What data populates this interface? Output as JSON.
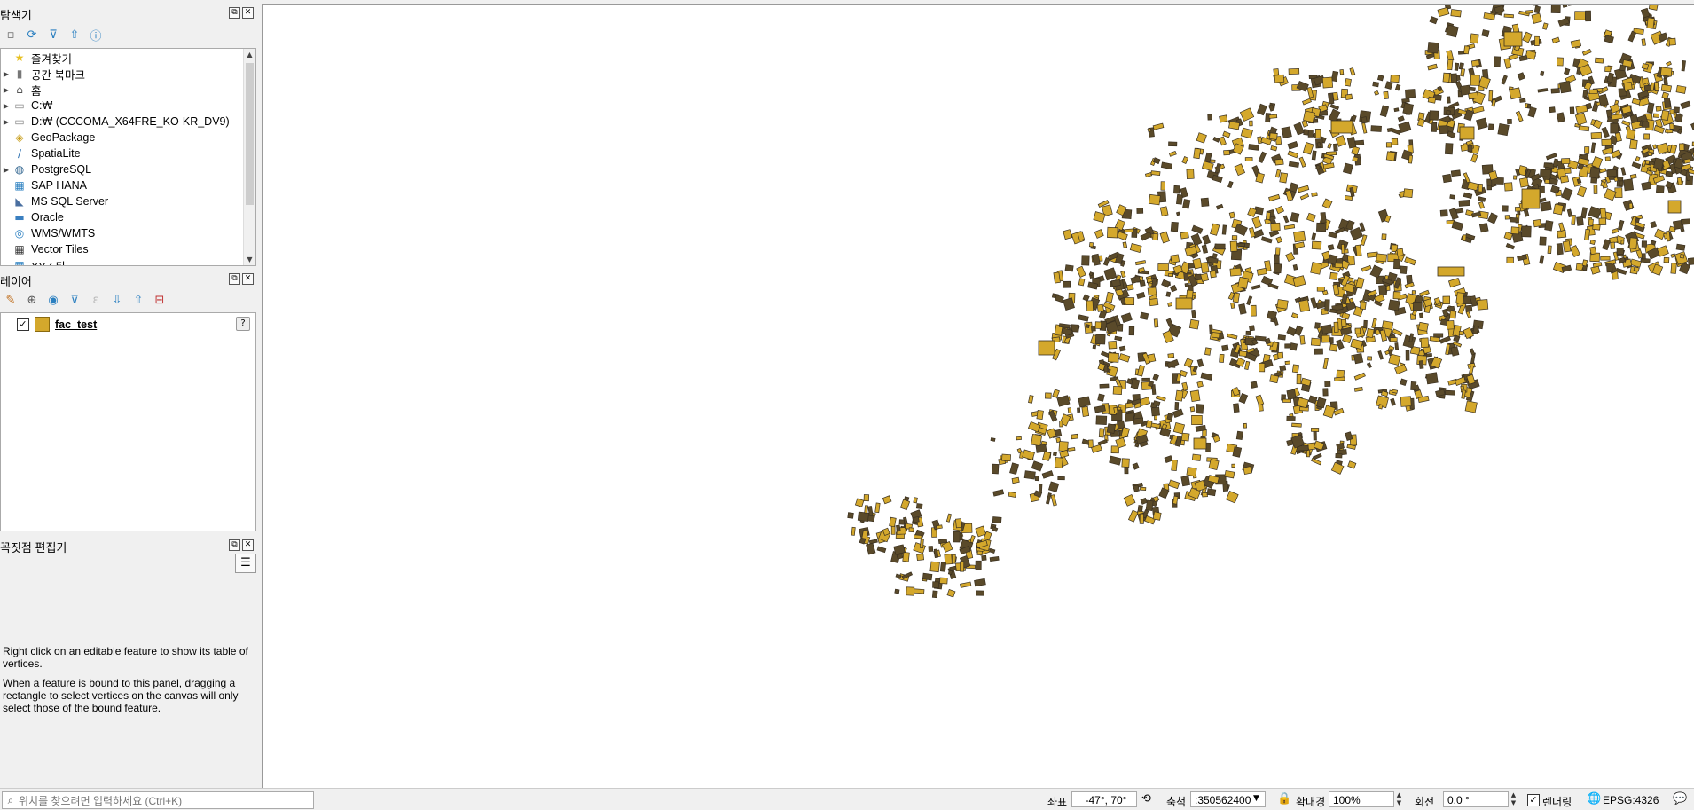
{
  "browser_panel": {
    "title": "탐색기",
    "items": [
      {
        "label": "즐겨찾기",
        "icon": "star-icon",
        "expandable": false
      },
      {
        "label": "공간 북마크",
        "icon": "bookmark-icon",
        "expandable": true
      },
      {
        "label": "홈",
        "icon": "home-folder-icon",
        "expandable": true
      },
      {
        "label": "C:₩",
        "icon": "folder-icon",
        "expandable": true
      },
      {
        "label": "D:₩ (CCCOMA_X64FRE_KO-KR_DV9)",
        "icon": "folder-icon",
        "expandable": true
      },
      {
        "label": "GeoPackage",
        "icon": "geopackage-icon",
        "expandable": false
      },
      {
        "label": "SpatiaLite",
        "icon": "spatialite-icon",
        "expandable": false
      },
      {
        "label": "PostgreSQL",
        "icon": "postgresql-icon",
        "expandable": true
      },
      {
        "label": "SAP HANA",
        "icon": "sap-hana-icon",
        "expandable": false
      },
      {
        "label": "MS SQL Server",
        "icon": "mssql-icon",
        "expandable": false
      },
      {
        "label": "Oracle",
        "icon": "oracle-icon",
        "expandable": false
      },
      {
        "label": "WMS/WMTS",
        "icon": "wms-icon",
        "expandable": false
      },
      {
        "label": "Vector Tiles",
        "icon": "vector-tiles-icon",
        "expandable": false
      },
      {
        "label": "XYZ 타",
        "icon": "xyz-icon",
        "expandable": false
      }
    ]
  },
  "layers_panel": {
    "title": "레이어",
    "layer": {
      "name": "fac_test",
      "checked": true,
      "color": "#d4a82c"
    }
  },
  "vertex_panel": {
    "title": "꼭짓점 편집기",
    "text1": "Right click on an editable feature to show its table of vertices.",
    "text2": "When a feature is bound to this panel, dragging a rectangle to select vertices on the canvas will only select those of the bound feature."
  },
  "statusbar": {
    "locator_placeholder": "위치를 찾으려면 입력하세요 (Ctrl+K)",
    "coordinate_label": "좌표",
    "coordinate_value": "-47°, 70°",
    "scale_label": "축척",
    "scale_value": ":350562400",
    "magnifier_label": "확대경",
    "magnifier_value": "100%",
    "rotation_label": "회전",
    "rotation_value": "0.0 °",
    "render_label": "렌더링",
    "render_checked": true,
    "crs_label": "EPSG:4326"
  },
  "colors": {
    "feature_fill": "#d4a82c",
    "feature_stroke": "#3a3020"
  }
}
